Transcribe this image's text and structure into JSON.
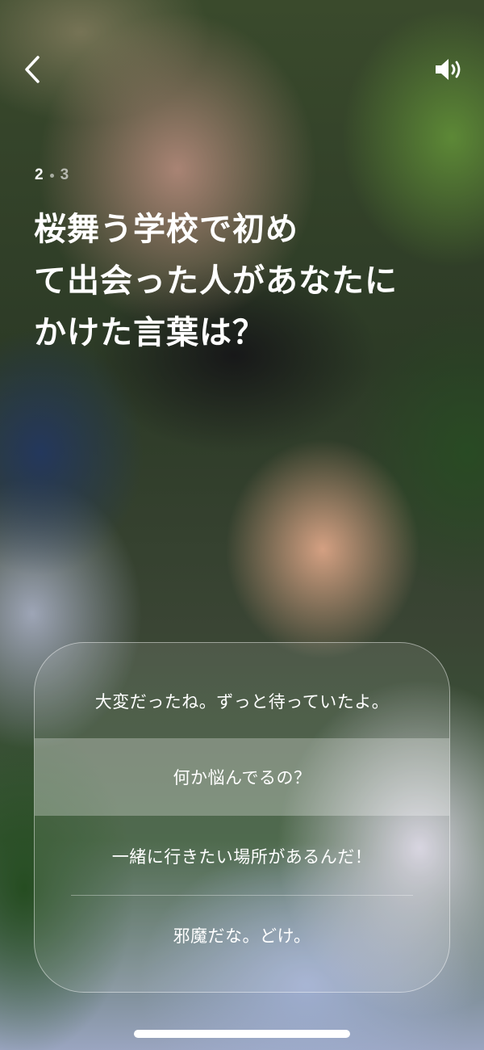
{
  "nav": {
    "back_icon": "chevron-left-icon",
    "sound_icon": "speaker-volume-icon"
  },
  "progress": {
    "current": "2",
    "total": "3"
  },
  "question": {
    "lines": [
      "桜舞う学校で初め",
      "て出会った人があなたに",
      "かけた言葉は？"
    ]
  },
  "choices": [
    {
      "label": "大変だったね。ずっと待っていたよ。",
      "selected": false
    },
    {
      "label": "何か悩んでるの？",
      "selected": true
    },
    {
      "label": "一緒に行きたい場所があるんだ！",
      "selected": false
    },
    {
      "label": "邪魔だな。どけ。",
      "selected": false
    }
  ],
  "colors": {
    "text": "#ffffff",
    "highlight": "rgba(255,255,255,0.28)"
  }
}
